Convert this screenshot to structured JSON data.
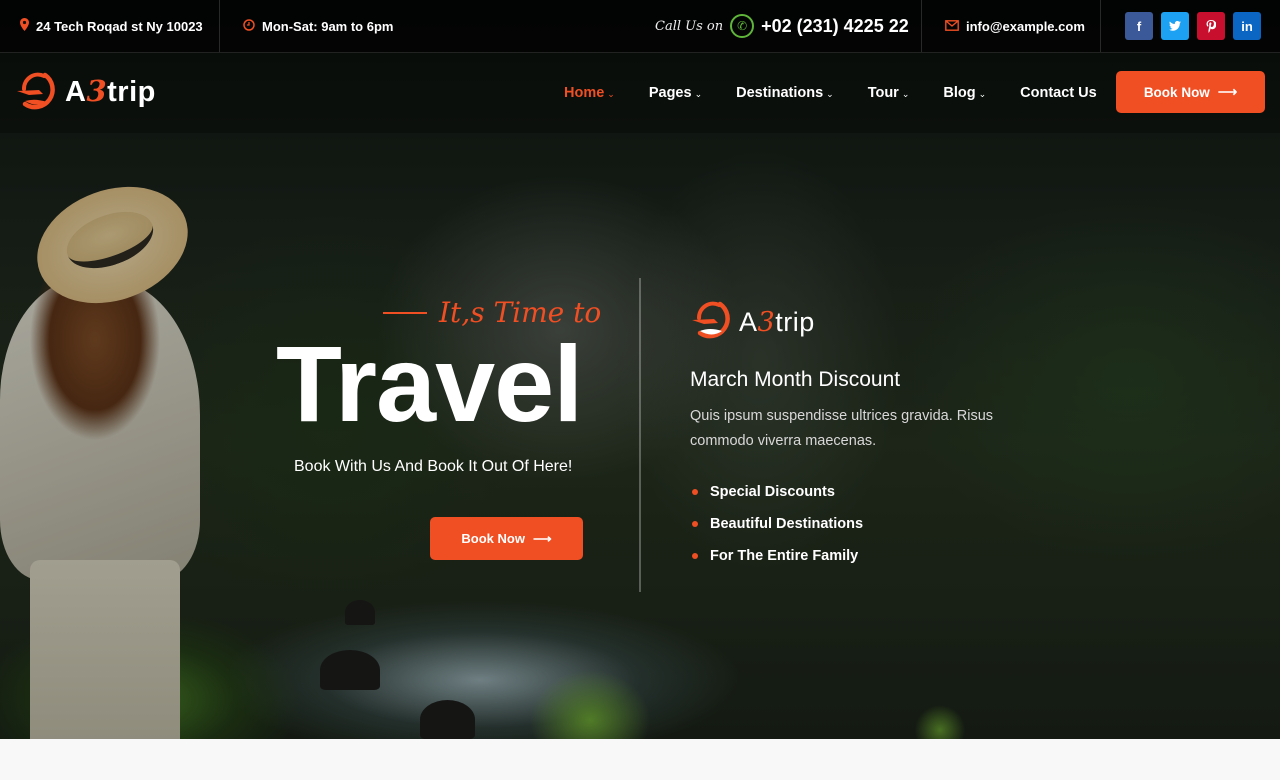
{
  "colors": {
    "accent": "#f04e23",
    "facebook": "#3b5998",
    "twitter": "#1da1f2",
    "pinterest": "#c8102e",
    "linkedin": "#0a66c2",
    "whatsapp": "#5fb53a"
  },
  "topbar": {
    "address": "24 Tech Roqad st Ny 10023",
    "address_icon": "map-marker-icon",
    "hours": "Mon-Sat: 9am to 6pm",
    "hours_icon": "clock-icon",
    "call_label": "Call Us on",
    "phone": "+02 (231) 4225 22",
    "phone_icon": "whatsapp-icon",
    "email": "info@example.com",
    "email_icon": "envelope-icon",
    "social": [
      {
        "name": "facebook",
        "glyph": "f"
      },
      {
        "name": "twitter",
        "glyph": "🐦"
      },
      {
        "name": "pinterest",
        "glyph": "P"
      },
      {
        "name": "linkedin",
        "glyph": "in"
      }
    ]
  },
  "navbar": {
    "logo": {
      "prefix": "A",
      "accent": "3",
      "suffix": "trip"
    },
    "items": [
      {
        "label": "Home",
        "dropdown": true,
        "active": true
      },
      {
        "label": "Pages",
        "dropdown": true
      },
      {
        "label": "Destinations",
        "dropdown": true
      },
      {
        "label": "Tour",
        "dropdown": true
      },
      {
        "label": "Blog",
        "dropdown": true
      },
      {
        "label": "Contact Us",
        "dropdown": false
      }
    ],
    "chevron": "⌄",
    "book_button": "Book Now",
    "arrow": "⟶"
  },
  "hero": {
    "tagline": "It,s Time to",
    "title": "Travel",
    "subtitle": "Book With Us And Book It Out Of Here!",
    "book_button": "Book Now",
    "arrow": "⟶"
  },
  "promo": {
    "logo": {
      "prefix": "A",
      "accent": "3",
      "suffix": "trip"
    },
    "title": "March Month Discount",
    "text": "Quis ipsum suspendisse ultrices gravida. Risus commodo viverra maecenas.",
    "features": [
      "Special Discounts",
      "Beautiful Destinations",
      "For The Entire Family"
    ]
  }
}
